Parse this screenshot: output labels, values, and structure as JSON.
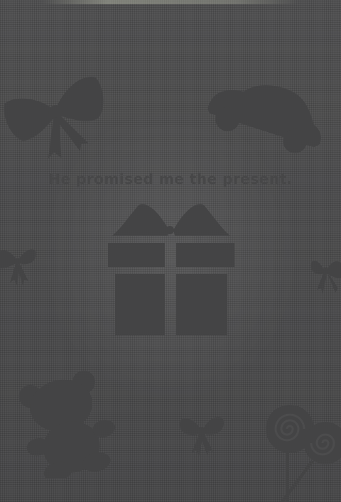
{
  "scene": {
    "message": "He promised me the present.",
    "background_color": "#515152",
    "silhouette_color": "#444445"
  },
  "decorations": [
    "bow-icon",
    "car-icon",
    "gift-box-icon",
    "teddy-bear-icon",
    "lollipop-icon"
  ]
}
